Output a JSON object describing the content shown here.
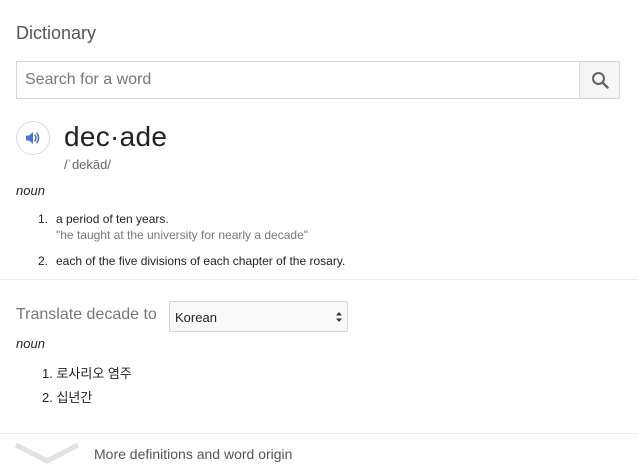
{
  "dictionary": {
    "title": "Dictionary",
    "search": {
      "placeholder": "Search for a word",
      "value": ""
    },
    "entry": {
      "word": "dec·ade",
      "phonetic": "/ˈdekād/",
      "part_of_speech": "noun",
      "definitions": [
        {
          "number": "1.",
          "text": "a period of ten years.",
          "example": "\"he taught at the university for nearly a decade\""
        },
        {
          "number": "2.",
          "text": "each of the five divisions of each chapter of the rosary.",
          "example": ""
        }
      ]
    },
    "translate": {
      "label": "Translate decade to",
      "selected_language": "Korean",
      "part_of_speech": "noun",
      "items": [
        {
          "number": "1.",
          "text": "로사리오 염주"
        },
        {
          "number": "2.",
          "text": "십년간"
        }
      ]
    },
    "more_link": "More definitions and word origin",
    "colors": {
      "accent": "#4a78c2",
      "muted_text": "#777777",
      "border": "#d6d6d6"
    },
    "icons": {
      "search": "search-icon",
      "speaker": "speaker-icon",
      "select_arrows": "select-arrows-icon",
      "more": "chevron-down-icon"
    }
  }
}
